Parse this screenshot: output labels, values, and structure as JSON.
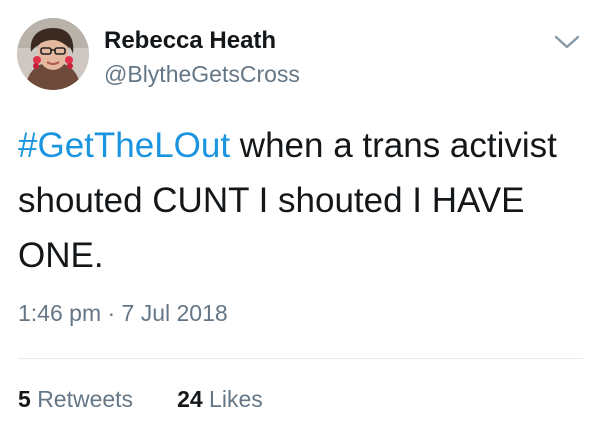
{
  "user": {
    "display_name": "Rebecca Heath",
    "handle": "@BlytheGetsCross",
    "avatar_icon": "profile-photo"
  },
  "tweet": {
    "hashtag": "#GetTheLOut",
    "text_after_hashtag": " when a trans activist shouted CUNT I shouted I HAVE ONE.",
    "timestamp": "1:46 pm · 7 Jul 2018"
  },
  "stats": {
    "retweets_count": "5",
    "retweets_label": "Retweets",
    "likes_count": "24",
    "likes_label": "Likes"
  },
  "menu_icon": "chevron-down-icon",
  "colors": {
    "hashtag": "#1b95e0",
    "secondary_text": "#657786",
    "primary_text": "#14171a",
    "divider": "#e6ecf0"
  }
}
